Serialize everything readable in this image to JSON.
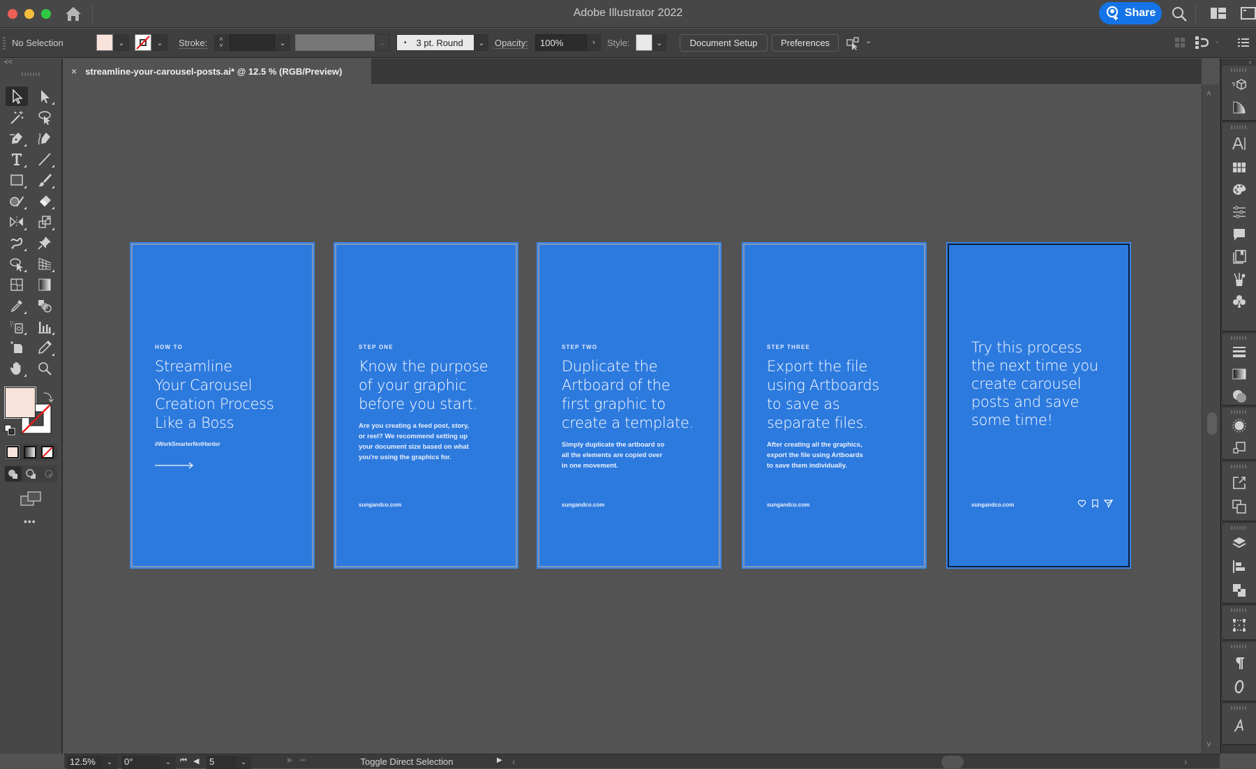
{
  "window": {
    "title": "Adobe Illustrator 2022",
    "share_label": "Share"
  },
  "control_bar": {
    "selection_label": "No Selection",
    "fill_color": "#f9e2da",
    "stroke_label": "Stroke:",
    "stroke_weight": "",
    "brush_label": "3 pt. Round",
    "opacity_label": "Opacity:",
    "opacity_value": "100%",
    "style_label": "Style:",
    "document_setup_label": "Document Setup",
    "preferences_label": "Preferences"
  },
  "document_tab": {
    "close_label": "×",
    "name": "streamline-your-carousel-posts.ai* @ 12.5 % (RGB/Preview)"
  },
  "toolbar": {
    "collapse_label": "<<",
    "fill_color": "#f9e2da",
    "more_label": "•••",
    "tools": [
      "selection-tool",
      "direct-selection-tool",
      "magic-wand-tool",
      "lasso-tool",
      "pen-tool",
      "curvature-tool",
      "type-tool",
      "line-segment-tool",
      "rectangle-tool",
      "paintbrush-tool",
      "shaper-tool",
      "eraser-tool",
      "reflect-tool",
      "scale-tool",
      "puppet-warp-tool",
      "pin-tool",
      "shape-builder-tool",
      "perspective-grid-tool",
      "mesh-tool",
      "gradient-tool",
      "eyedropper-tool",
      "blend-tool",
      "symbol-sprayer-tool",
      "column-graph-tool",
      "artboard-tool",
      "pencil-tool",
      "hand-tool",
      "zoom-tool"
    ]
  },
  "artboards": [
    {
      "eyebrow": "HOW TO",
      "title": "Streamline\nYour Carousel\nCreation Process\nLike a Boss",
      "tag": "#WorkSmarterNotHarder",
      "body": "",
      "footer": ""
    },
    {
      "eyebrow": "STEP ONE",
      "title": "Know the purpose\nof your graphic\nbefore you start.",
      "body": "Are you creating a feed post, story,\nor reel? We recommend setting up\nyour document size based on what\nyou're using the graphics for.",
      "footer": "sungandco.com"
    },
    {
      "eyebrow": "STEP TWO",
      "title": "Duplicate the\nArtboard of the\nfirst graphic to\ncreate a template.",
      "body": "Simply duplicate the artboard so\nall the elements are copied over\nin one movement.",
      "footer": "sungandco.com"
    },
    {
      "eyebrow": "STEP THREE",
      "title": "Export the file\nusing Artboards\nto save as\nseparate files.",
      "body": "After creating all the graphics,\nexport the file using Artboards\nto save them individually.",
      "footer": "sungandco.com"
    },
    {
      "eyebrow": "",
      "title": "Try this process\nthe next time you\ncreate carousel\nposts and save\nsome time!",
      "body": "",
      "footer": "sungandco.com",
      "icons": [
        "heart-icon",
        "bookmark-icon",
        "send-icon"
      ]
    }
  ],
  "colors": {
    "artboard_fill": "#2d7ade",
    "accent": "#1473e6"
  },
  "status_bar": {
    "zoom": "12.5%",
    "rotation": "0°",
    "artboard_number": "5",
    "status_text": "Toggle Direct Selection"
  }
}
